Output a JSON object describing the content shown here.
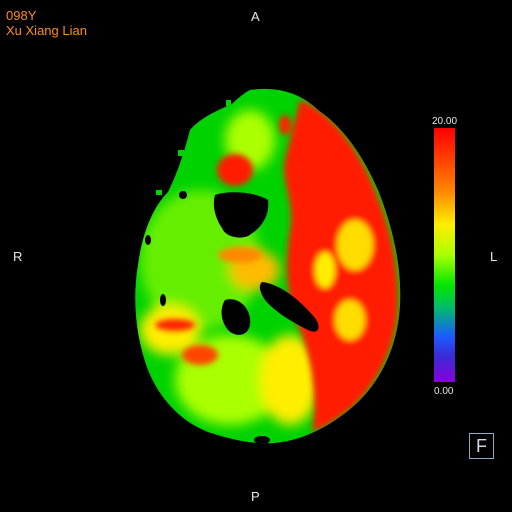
{
  "patient": {
    "id": "098Y",
    "name": "Xu Xiang Lian"
  },
  "orientation": {
    "anterior": "A",
    "posterior": "P",
    "right": "R",
    "left": "L"
  },
  "colorbar": {
    "max_label": "20.00",
    "min_label": "0.00",
    "colors": [
      "#ff0000",
      "#ff8800",
      "#ffee00",
      "#00e600",
      "#1a5cff",
      "#8a00d8"
    ]
  },
  "controls": {
    "f_button_label": "F"
  },
  "perfusion_map": {
    "colors": {
      "background": "#000000",
      "low": "#00d200",
      "mid_low": "#9bff00",
      "mid": "#ffee00",
      "mid_high": "#ff8800",
      "high": "#ff0000"
    }
  }
}
